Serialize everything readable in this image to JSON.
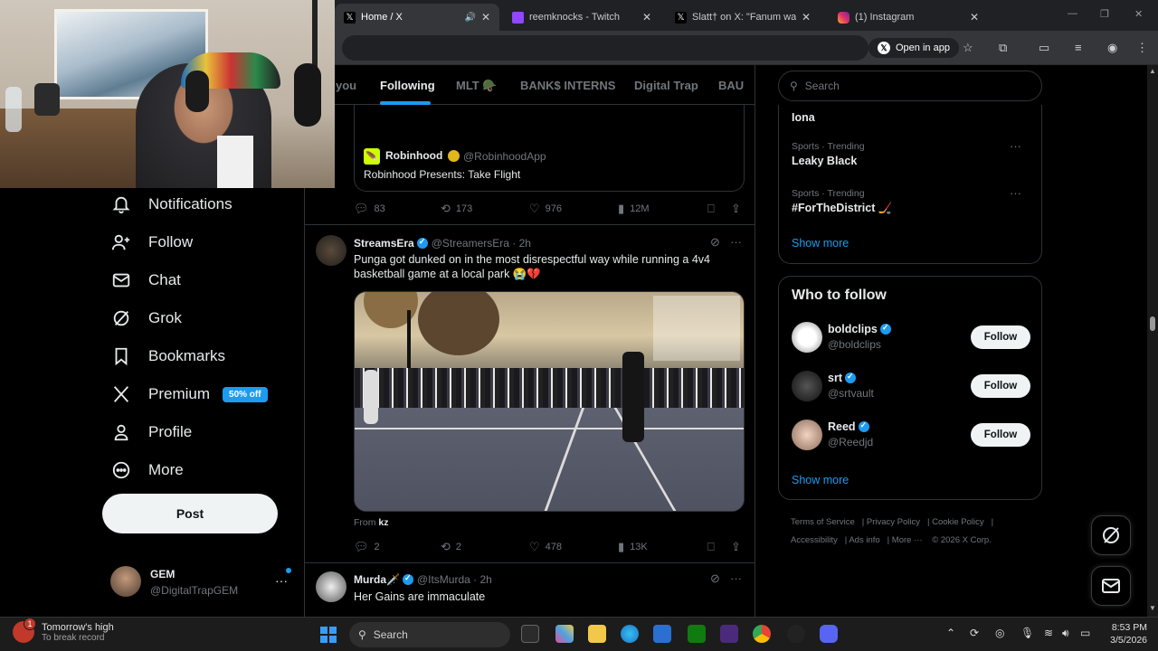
{
  "browser": {
    "tabs": [
      {
        "title": "Home / X",
        "favicon_color": "#000000"
      },
      {
        "title": "reemknocks - Twitch",
        "favicon_color": "#9146ff"
      },
      {
        "title": "Slatt† on X: \"Fanum was be",
        "favicon_color": "#000000"
      },
      {
        "title": "(1) Instagram",
        "favicon_color": "#e1306c"
      }
    ],
    "open_in_app": "Open in app"
  },
  "feed": {
    "tabs": [
      "you",
      "Following",
      "MLT 🪖",
      "BANK$ INTERNS",
      "Digital Trap",
      "BAU"
    ],
    "quote": {
      "name": "Robinhood",
      "handle": "@RobinhoodApp",
      "text": "Robinhood Presents: Take Flight"
    },
    "quote_actions": {
      "replies": "83",
      "reposts": "173",
      "likes": "976",
      "views": "12M"
    },
    "post1": {
      "name": "StreamsEra",
      "handle": "@StreamersEra · 2h",
      "text": "Punga got dunked on in the most disrespectful way while running a 4v4 basketball game at a local park 😭💔",
      "from_label": "From",
      "from_user": "kz",
      "replies": "2",
      "reposts": "2",
      "likes": "478",
      "views": "13K"
    },
    "post2": {
      "name": "Murda🗡️",
      "handle": "@ItsMurda · 2h",
      "text": "Her Gains are immaculate"
    }
  },
  "sidebar": {
    "items": [
      {
        "label": "Notifications",
        "icon": "bell-icon"
      },
      {
        "label": "Follow",
        "icon": "person-plus-icon"
      },
      {
        "label": "Chat",
        "icon": "envelope-icon"
      },
      {
        "label": "Grok",
        "icon": "grok-icon"
      },
      {
        "label": "Bookmarks",
        "icon": "bookmark-icon"
      },
      {
        "label": "Premium",
        "icon": "x-logo-icon"
      },
      {
        "label": "Profile",
        "icon": "person-icon"
      },
      {
        "label": "More",
        "icon": "more-circle-icon"
      }
    ],
    "premium_badge": "50% off",
    "post_button": "Post",
    "account": {
      "name": "GEM",
      "handle": "@DigitalTrapGEM"
    }
  },
  "right": {
    "search_placeholder": "Search",
    "trends": [
      {
        "meta": "",
        "name": "Iona"
      },
      {
        "meta": "Sports · Trending",
        "name": "Leaky Black"
      },
      {
        "meta": "Sports · Trending",
        "name": "#ForTheDistrict 🏒"
      }
    ],
    "show_more": "Show more",
    "who_to_follow": {
      "title": "Who to follow",
      "users": [
        {
          "name": "boldclips",
          "handle": "@boldclips",
          "button": "Follow"
        },
        {
          "name": "srt",
          "handle": "@srtvault",
          "button": "Follow"
        },
        {
          "name": "Reed",
          "handle": "@Reedjd",
          "button": "Follow"
        }
      ],
      "show_more": "Show more"
    },
    "footer": [
      "Terms of Service",
      "Privacy Policy",
      "Cookie Policy",
      "Accessibility",
      "Ads info",
      "More ···",
      "© 2026 X Corp."
    ]
  },
  "taskbar": {
    "weather_line1": "Tomorrow's high",
    "weather_line2": "To break record",
    "weather_badge": "1",
    "search": "Search",
    "time": "8:53 PM",
    "date": "3/5/2026"
  },
  "colors": {
    "accent": "#1d9bf0",
    "background": "#000000",
    "border": "#2f3336",
    "muted": "#71767b"
  }
}
